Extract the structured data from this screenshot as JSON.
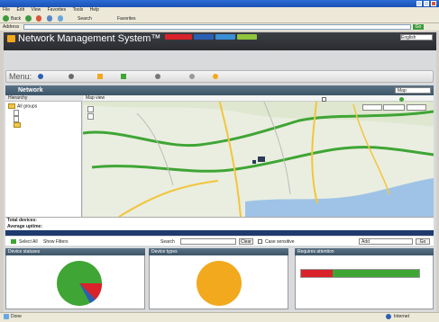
{
  "browser": {
    "title": "",
    "menu": [
      "File",
      "Edit",
      "View",
      "Favorites",
      "Tools",
      "Help"
    ],
    "back_label": "Back",
    "search_label": "Search",
    "favorites_label": "Favorites",
    "address_label": "Address",
    "address": "",
    "go_label": "Go"
  },
  "app": {
    "title": "Network Management System™",
    "brand_mark": "",
    "header_badges": [
      "",
      "",
      "",
      ""
    ],
    "header_fields": [
      "",
      "",
      ""
    ],
    "language_label": "",
    "language_value": "English",
    "header_links": [
      "",
      ""
    ]
  },
  "menu": {
    "label": "Menu:",
    "items": [
      "",
      "",
      "",
      "",
      "",
      "",
      ""
    ]
  },
  "network": {
    "title": "Network",
    "select_label": "",
    "select_value": "Map",
    "hierarchy_header": "Hierarchy",
    "tree": [
      "All groups",
      "",
      "",
      ""
    ]
  },
  "map": {
    "header": "Map view",
    "option_label": "",
    "refresh_label": "",
    "types": [
      "",
      "",
      ""
    ],
    "labels": [
      "",
      "",
      "",
      "",
      "",
      "",
      "",
      "",
      "",
      "",
      "",
      "",
      "",
      "",
      ""
    ],
    "copyright": ""
  },
  "summary": {
    "rows": [
      {
        "label": "Total devices:",
        "value": ""
      },
      {
        "label": "Average uptime:",
        "value": ""
      }
    ],
    "select_all": "Select All",
    "show_filters": "Show Filters",
    "search_label": "Search",
    "clear_label": "Clear",
    "case_label": "Case sensitive",
    "add_label": "Add",
    "go_label": "Go"
  },
  "cards": [
    {
      "title": "Device statuses",
      "legend": [
        "",
        "",
        ""
      ]
    },
    {
      "title": "Device types",
      "legend": [
        "",
        ""
      ]
    },
    {
      "title": "Requires attention",
      "caption": ""
    }
  ],
  "colors": {
    "up": "#3fa535",
    "down": "#d9222a",
    "alert": "#f2a91d",
    "other": "#2b5fb3"
  },
  "footer": "",
  "statusbar": {
    "left": "Done",
    "zone": "Internet"
  }
}
